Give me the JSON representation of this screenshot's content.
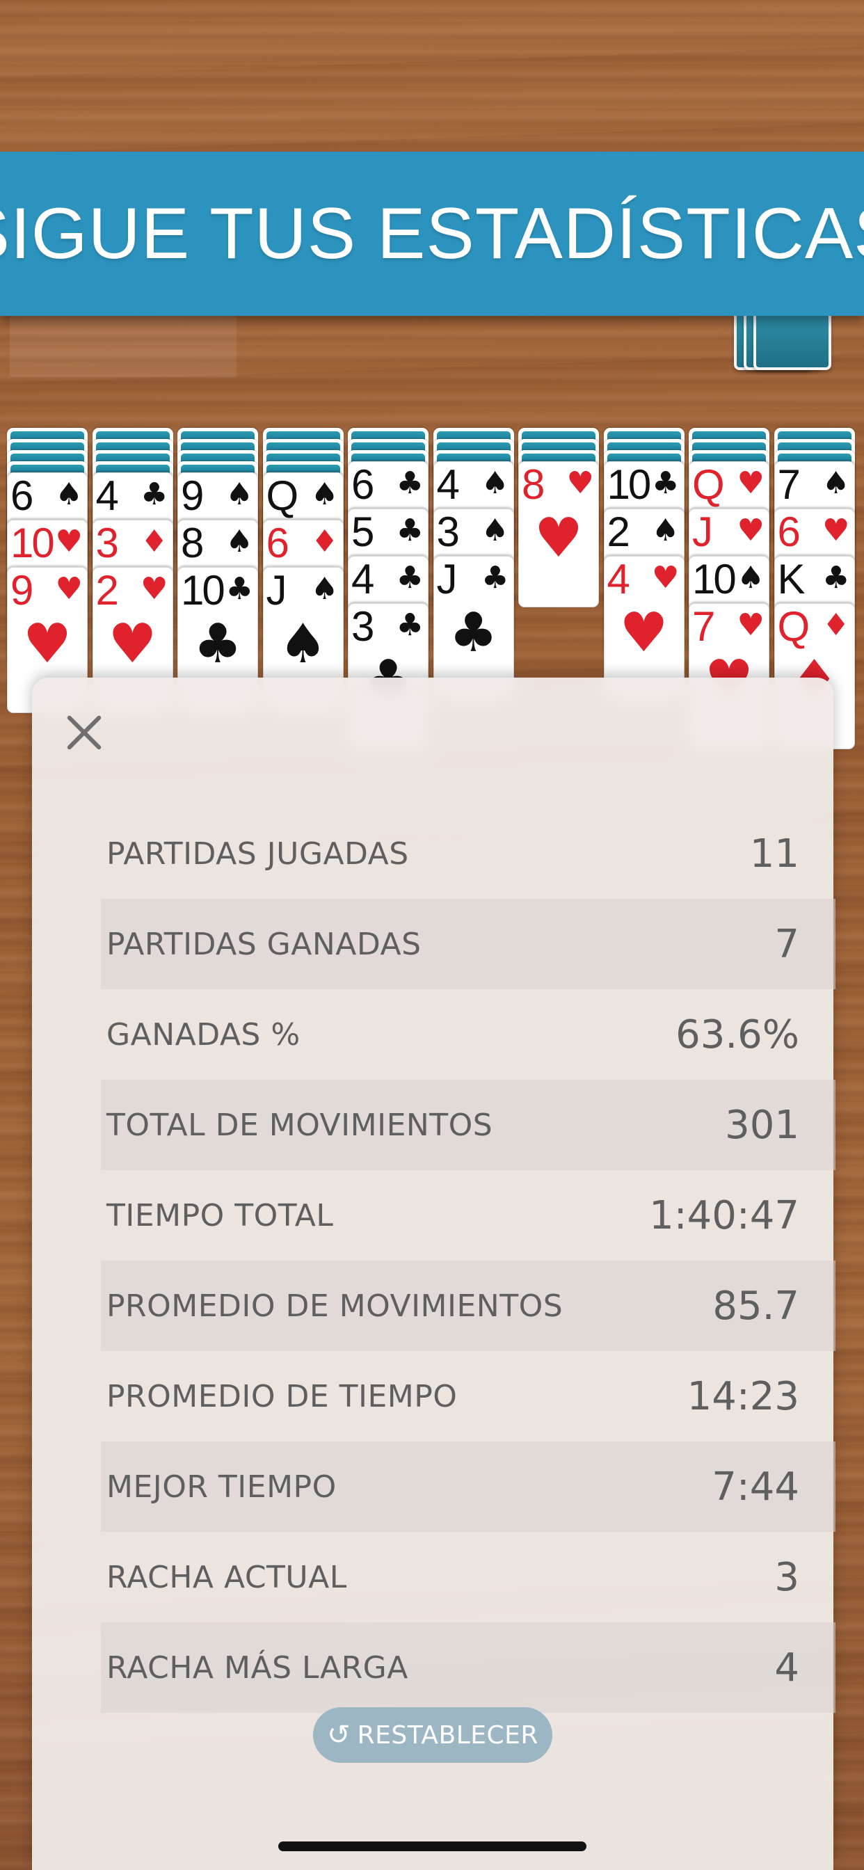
{
  "banner": {
    "title": "SIGUE TUS ESTADÍSTICAS"
  },
  "colors": {
    "banner": "#2c93be",
    "card_back": "#1f8aa3",
    "red_suit": "#e0222d",
    "panel": "#f0ebe8",
    "reset_button": "#9cb6c3"
  },
  "tableau": {
    "piles": [
      {
        "backs": 4,
        "cards": [
          {
            "rank": "6",
            "suit": "♠"
          },
          {
            "rank": "10",
            "suit": "♥"
          },
          {
            "rank": "9",
            "suit": "♥"
          }
        ]
      },
      {
        "backs": 4,
        "cards": [
          {
            "rank": "4",
            "suit": "♣"
          },
          {
            "rank": "3",
            "suit": "♦"
          },
          {
            "rank": "2",
            "suit": "♥"
          }
        ]
      },
      {
        "backs": 4,
        "cards": [
          {
            "rank": "9",
            "suit": "♠"
          },
          {
            "rank": "8",
            "suit": "♠"
          },
          {
            "rank": "10",
            "suit": "♣"
          }
        ]
      },
      {
        "backs": 4,
        "cards": [
          {
            "rank": "Q",
            "suit": "♠"
          },
          {
            "rank": "6",
            "suit": "♦"
          },
          {
            "rank": "J",
            "suit": "♠"
          }
        ]
      },
      {
        "backs": 3,
        "cards": [
          {
            "rank": "6",
            "suit": "♣"
          },
          {
            "rank": "5",
            "suit": "♣"
          },
          {
            "rank": "4",
            "suit": "♣"
          },
          {
            "rank": "3",
            "suit": "♣"
          }
        ]
      },
      {
        "backs": 3,
        "cards": [
          {
            "rank": "4",
            "suit": "♠"
          },
          {
            "rank": "3",
            "suit": "♠"
          },
          {
            "rank": "J",
            "suit": "♣"
          }
        ]
      },
      {
        "backs": 3,
        "cards": [
          {
            "rank": "8",
            "suit": "♥"
          }
        ]
      },
      {
        "backs": 3,
        "cards": [
          {
            "rank": "10",
            "suit": "♣"
          },
          {
            "rank": "2",
            "suit": "♠"
          },
          {
            "rank": "4",
            "suit": "♥"
          }
        ]
      },
      {
        "backs": 3,
        "cards": [
          {
            "rank": "Q",
            "suit": "♥"
          },
          {
            "rank": "J",
            "suit": "♥"
          },
          {
            "rank": "10",
            "suit": "♠"
          },
          {
            "rank": "7",
            "suit": "♥"
          }
        ]
      },
      {
        "backs": 3,
        "cards": [
          {
            "rank": "7",
            "suit": "♠"
          },
          {
            "rank": "6",
            "suit": "♥"
          },
          {
            "rank": "K",
            "suit": "♣"
          },
          {
            "rank": "Q",
            "suit": "♦"
          }
        ]
      }
    ]
  },
  "stats": {
    "rows": [
      {
        "label": "PARTIDAS JUGADAS",
        "value": "11"
      },
      {
        "label": "PARTIDAS GANADAS",
        "value": "7"
      },
      {
        "label": "GANADAS %",
        "value": "63.6%"
      },
      {
        "label": "TOTAL DE MOVIMIENTOS",
        "value": "301"
      },
      {
        "label": "TIEMPO TOTAL",
        "value": "1:40:47"
      },
      {
        "label": "PROMEDIO DE MOVIMIENTOS",
        "value": "85.7"
      },
      {
        "label": "PROMEDIO DE TIEMPO",
        "value": "14:23"
      },
      {
        "label": "MEJOR TIEMPO",
        "value": "7:44"
      },
      {
        "label": "RACHA ACTUAL",
        "value": "3"
      },
      {
        "label": "RACHA MÁS LARGA",
        "value": "4"
      }
    ]
  },
  "reset": {
    "label": "RESTABLECER",
    "icon": "reset-arrow-icon"
  },
  "close": {
    "icon": "close-icon"
  }
}
